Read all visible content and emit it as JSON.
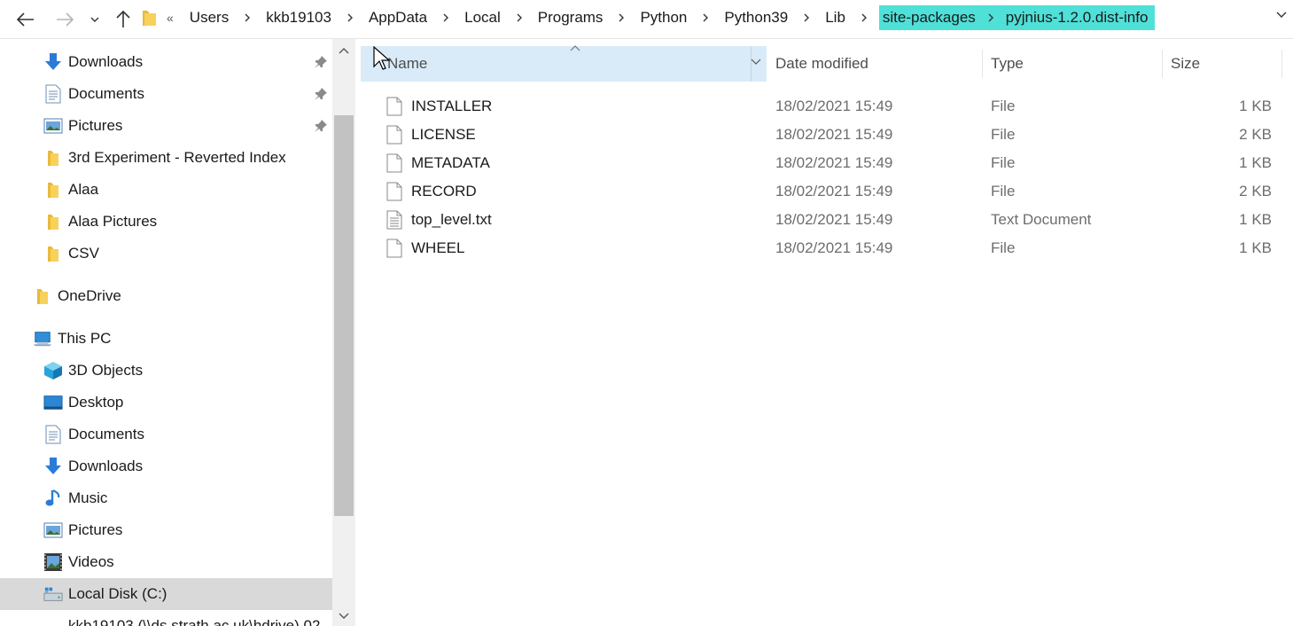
{
  "address_bar": {
    "overflow": "«",
    "crumbs": [
      "Users",
      "kkb19103",
      "AppData",
      "Local",
      "Programs",
      "Python",
      "Python39",
      "Lib"
    ],
    "highlighted_crumbs": [
      "site-packages",
      "pyjnius-1.2.0.dist-info"
    ],
    "highlight_color": "#4fe0d8"
  },
  "nav_pane": {
    "quick_access": [
      {
        "label": "Downloads",
        "icon": "download-arrow-icon",
        "pinned": true
      },
      {
        "label": "Documents",
        "icon": "documents-icon",
        "pinned": true
      },
      {
        "label": "Pictures",
        "icon": "pictures-icon",
        "pinned": true
      },
      {
        "label": "3rd Experiment - Reverted Index",
        "icon": "folder-icon",
        "pinned": false
      },
      {
        "label": "Alaa",
        "icon": "folder-icon",
        "pinned": false
      },
      {
        "label": "Alaa Pictures",
        "icon": "folder-icon",
        "pinned": false
      },
      {
        "label": "CSV",
        "icon": "folder-icon",
        "pinned": false
      }
    ],
    "onedrive": "OneDrive",
    "this_pc": "This PC",
    "this_pc_items": [
      {
        "label": "3D Objects",
        "icon": "3d-objects-icon"
      },
      {
        "label": "Desktop",
        "icon": "desktop-icon"
      },
      {
        "label": "Documents",
        "icon": "documents-icon"
      },
      {
        "label": "Downloads",
        "icon": "download-arrow-icon"
      },
      {
        "label": "Music",
        "icon": "music-note-icon"
      },
      {
        "label": "Pictures",
        "icon": "pictures-icon"
      },
      {
        "label": "Videos",
        "icon": "videos-icon"
      },
      {
        "label": "Local Disk (C:)",
        "icon": "local-disk-icon",
        "selected": true
      }
    ],
    "partial_item": "kkb19103 (\\\\ds.strath.ac.uk\\hdrive) 02"
  },
  "columns": {
    "name": "Name",
    "date": "Date modified",
    "type": "Type",
    "size": "Size"
  },
  "files": [
    {
      "name": "INSTALLER",
      "date": "18/02/2021 15:49",
      "type": "File",
      "size": "1 KB",
      "icon": "blank-file-icon"
    },
    {
      "name": "LICENSE",
      "date": "18/02/2021 15:49",
      "type": "File",
      "size": "2 KB",
      "icon": "blank-file-icon"
    },
    {
      "name": "METADATA",
      "date": "18/02/2021 15:49",
      "type": "File",
      "size": "1 KB",
      "icon": "blank-file-icon"
    },
    {
      "name": "RECORD",
      "date": "18/02/2021 15:49",
      "type": "File",
      "size": "2 KB",
      "icon": "blank-file-icon"
    },
    {
      "name": "top_level.txt",
      "date": "18/02/2021 15:49",
      "type": "Text Document",
      "size": "1 KB",
      "icon": "text-file-icon"
    },
    {
      "name": "WHEEL",
      "date": "18/02/2021 15:49",
      "type": "File",
      "size": "1 KB",
      "icon": "blank-file-icon"
    }
  ]
}
